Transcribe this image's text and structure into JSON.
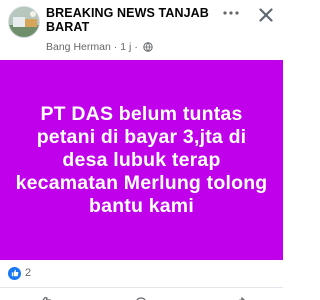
{
  "post": {
    "group_name": "BREAKING NEWS TANJAB BARAT",
    "author": "Bang Herman",
    "timestamp": "1 j",
    "separator": "·",
    "body": "PT DAS belum tuntas petani di bayar 3,jta di desa lubuk terap kecamatan Merlung tolong bantu kami",
    "background_color": "#c000ea"
  },
  "reactions": {
    "icon": "like-icon",
    "count": "2"
  },
  "icons": {
    "menu": "more-icon",
    "close": "close-icon",
    "privacy": "globe-icon"
  }
}
